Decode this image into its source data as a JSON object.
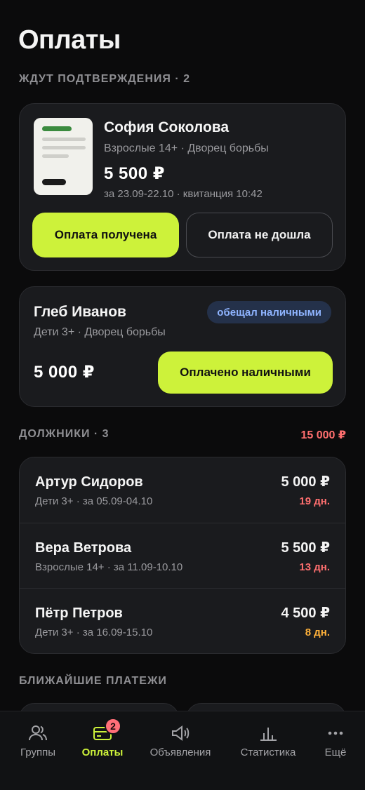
{
  "page": {
    "title": "Оплаты"
  },
  "pending": {
    "header": "ЖДУТ ПОДТВЕРЖДЕНИЯ · 2",
    "card1": {
      "name": "София Соколова",
      "group": "Взрослые 14+ · Дворец борьбы",
      "amount": "5 500 ₽",
      "meta": "за 23.09-22.10 · квитанция 10:42",
      "confirm_label": "Оплата получена",
      "reject_label": "Оплата не дошла"
    },
    "card2": {
      "name": "Глеб Иванов",
      "group": "Дети 3+ · Дворец борьбы",
      "badge": "обещал наличными",
      "amount": "5 000 ₽",
      "confirm_label": "Оплачено наличными"
    }
  },
  "debtors": {
    "header": "ДОЛЖНИКИ · 3",
    "total": "15 000 ₽",
    "items": [
      {
        "name": "Артур Сидоров",
        "sub": "Дети 3+ · за 05.09-04.10",
        "amount": "5 000 ₽",
        "days": "19 дн.",
        "days_color": "#ff6f6f"
      },
      {
        "name": "Вера Ветрова",
        "sub": "Взрослые 14+ · за 11.09-10.10",
        "amount": "5 500 ₽",
        "days": "13 дн.",
        "days_color": "#ff6f6f"
      },
      {
        "name": "Пётр Петров",
        "sub": "Дети 3+ · за 16.09-15.10",
        "amount": "4 500 ₽",
        "days": "8 дн.",
        "days_color": "#ffb13a"
      }
    ]
  },
  "upcoming": {
    "header": "БЛИЖАЙШИЕ ПЛАТЕЖИ"
  },
  "nav": {
    "items": [
      {
        "label": "Группы",
        "icon": "users-icon"
      },
      {
        "label": "Оплаты",
        "icon": "card-icon",
        "badge": "2",
        "active": true
      },
      {
        "label": "Объявления",
        "icon": "megaphone-icon"
      },
      {
        "label": "Статистика",
        "icon": "chart-icon"
      },
      {
        "label": "Ещё",
        "icon": "more-icon"
      }
    ]
  },
  "colors": {
    "accent": "#cdf23a",
    "danger": "#ff6f6f",
    "warning": "#ffb13a",
    "badge_text": "#8fb4ff"
  }
}
